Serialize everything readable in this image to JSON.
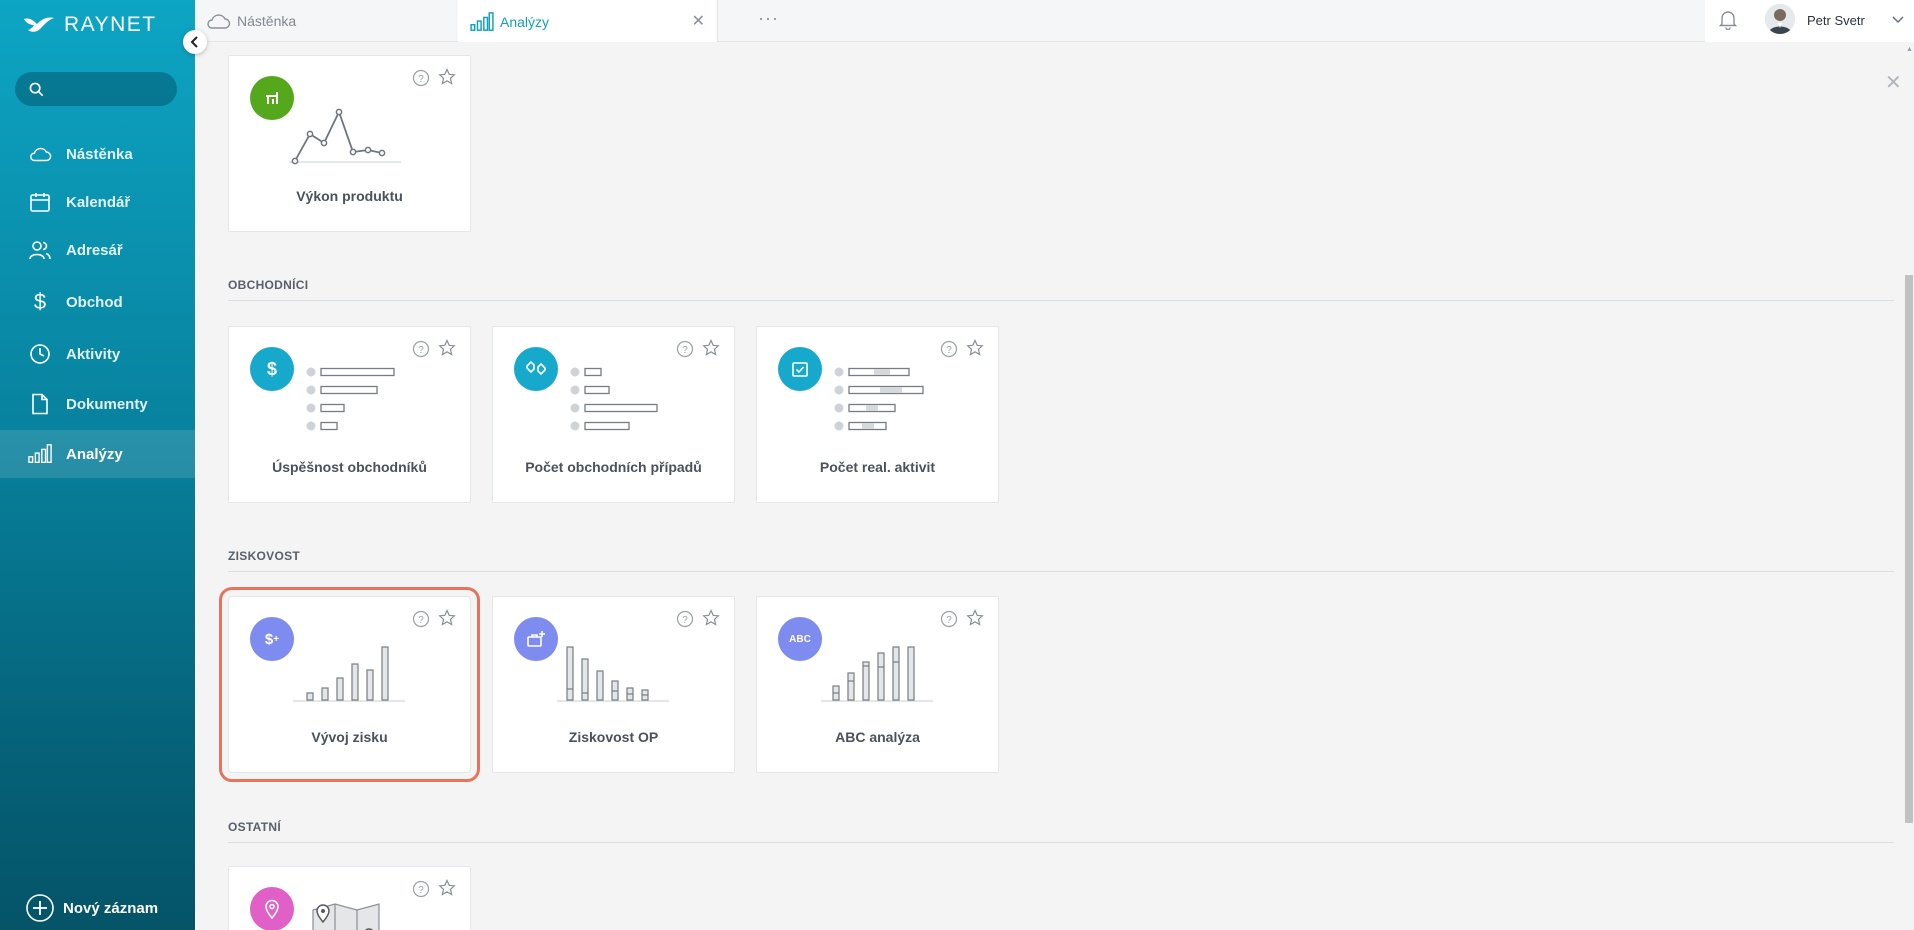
{
  "sidebar": {
    "logo_text": "RAYNET",
    "search_placeholder": "",
    "items": [
      {
        "label": "Nástěnka",
        "icon": "cloud-icon"
      },
      {
        "label": "Kalendář",
        "icon": "calendar-icon"
      },
      {
        "label": "Adresář",
        "icon": "contacts-icon"
      },
      {
        "label": "Obchod",
        "icon": "dollar-icon"
      },
      {
        "label": "Aktivity",
        "icon": "clock-icon"
      },
      {
        "label": "Dokumenty",
        "icon": "document-icon"
      },
      {
        "label": "Analýzy",
        "icon": "bar-chart-icon",
        "active": true
      }
    ],
    "new_record_label": "Nový záznam"
  },
  "topbar": {
    "tabs": [
      {
        "label": "Nástěnka",
        "icon": "cloud-icon"
      },
      {
        "label": "Analýzy",
        "icon": "bar-chart-icon",
        "active": true
      }
    ],
    "more_label": "···",
    "user_name": "Petr Svetr"
  },
  "sections": [
    {
      "title": "",
      "cards": [
        {
          "title": "Výkon produktu",
          "icon": "product-icon",
          "color": "#55a81c",
          "illustration": "line"
        }
      ]
    },
    {
      "title": "OBCHODNÍCI",
      "cards": [
        {
          "title": "Úspěšnost obchodníků",
          "icon": "dollar-icon",
          "color": "#17a9cc",
          "illustration": "hbars"
        },
        {
          "title": "Počet obchodních případů",
          "icon": "handshake-icon",
          "color": "#17a9cc",
          "illustration": "hbars"
        },
        {
          "title": "Počet real. aktivit",
          "icon": "checklist-icon",
          "color": "#17a9cc",
          "illustration": "hbars"
        }
      ]
    },
    {
      "title": "ZISKOVOST",
      "cards": [
        {
          "title": "Vývoj zisku",
          "icon": "dollar-plus-icon",
          "color": "#7e8cf0",
          "illustration": "vbars",
          "highlighted": true
        },
        {
          "title": "Ziskovost OP",
          "icon": "briefcase-plus-icon",
          "color": "#7e8cf0",
          "illustration": "vbars"
        },
        {
          "title": "ABC analýza",
          "icon_text": "ABC",
          "icon": "abc-icon",
          "color": "#7e8cf0",
          "illustration": "vbars"
        }
      ]
    },
    {
      "title": "OSTATNÍ",
      "cards": [
        {
          "title": "",
          "icon": "map-pin-icon",
          "color": "#e060c8",
          "illustration": "map"
        }
      ]
    }
  ]
}
